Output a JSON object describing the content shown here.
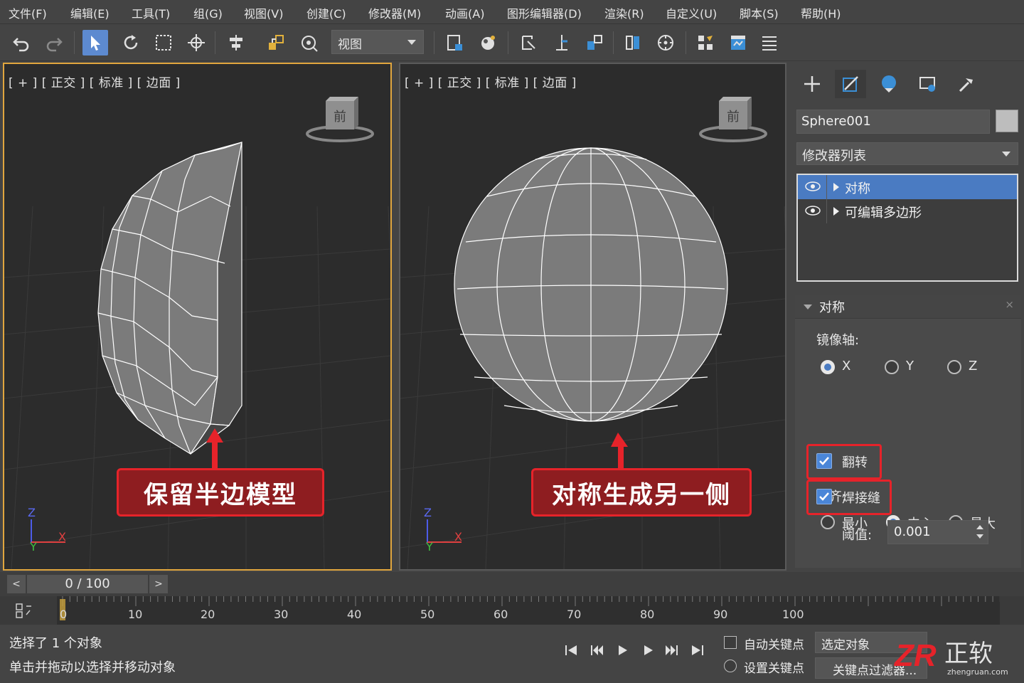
{
  "menu": [
    "文件(F)",
    "编辑(E)",
    "工具(T)",
    "组(G)",
    "视图(V)",
    "创建(C)",
    "修改器(M)",
    "动画(A)",
    "图形编辑器(D)",
    "渲染(R)",
    "自定义(U)",
    "脚本(S)",
    "帮助(H)"
  ],
  "toolbar": {
    "view_combo": "视图",
    "buttons": [
      "undo-icon",
      "redo-icon",
      "select-icon",
      "rotate-icon",
      "region-select-icon",
      "move-icon",
      "align-icon",
      "link-icon",
      "pivot-icon",
      "layer-icon",
      "material-icon",
      "snap-icon",
      "angle-snap-icon",
      "percent-snap-icon",
      "mirror-icon",
      "rotate-snap-icon",
      "schematic-icon",
      "render-setup-icon",
      "render-frame-icon",
      "ribbon-icon"
    ]
  },
  "viewports": {
    "left": {
      "label": "[ + ] [ 正交 ] [ 标准 ] [ 边面 ]",
      "viewcube": "前",
      "annotation": "保留半边模型",
      "axes": {
        "z": "Z",
        "y": "Y",
        "x": "X"
      }
    },
    "right": {
      "label": "[ + ] [ 正交 ] [ 标准 ] [ 边面 ]",
      "viewcube": "前",
      "annotation": "对称生成另一侧",
      "axes": {
        "z": "Z",
        "y": "Y",
        "x": "X"
      }
    }
  },
  "command_panel": {
    "tabs": [
      "create-icon",
      "modify-icon",
      "hierarchy-icon",
      "motion-icon",
      "utilities-icon"
    ],
    "object_name": "Sphere001",
    "object_color": "#bdbdbd",
    "modifier_list": "修改器列表",
    "stack": [
      {
        "label": "对称",
        "selected": true
      },
      {
        "label": "可编辑多边形",
        "selected": false
      }
    ],
    "rollout": {
      "title": "对称",
      "close": "×",
      "mirror_axis_label": "镜像轴:",
      "axes": [
        "X",
        "Y",
        "Z"
      ],
      "axis_selected": "X",
      "flip": "翻转",
      "flip_checked": true,
      "align_label": "对齐:",
      "align_options": [
        "最小",
        "中心",
        "最大"
      ],
      "align_selected": "中心",
      "weld": "焊接缝",
      "weld_checked": true,
      "threshold_label": "阈值:",
      "threshold_value": "0.001"
    }
  },
  "timeline": {
    "prev": "<",
    "slider": "0 / 100",
    "next": ">",
    "ticks": [
      "0",
      "10",
      "20",
      "30",
      "40",
      "50",
      "60",
      "70",
      "80",
      "90",
      "100"
    ]
  },
  "status": {
    "line1": "选择了 1 个对象",
    "line2": "单击并拖动以选择并移动对象",
    "auto_key": "自动关键点",
    "set_key": "设置关键点",
    "selected_object": "选定对象",
    "key_filters": "关键点过滤器..."
  },
  "watermark": {
    "logo": "ZR",
    "text": "正软",
    "url": "zhengruan.com"
  },
  "colors": {
    "accent": "#4a7bc2",
    "annotation_red": "#e6232a",
    "viewport_active": "#e1a63e"
  }
}
